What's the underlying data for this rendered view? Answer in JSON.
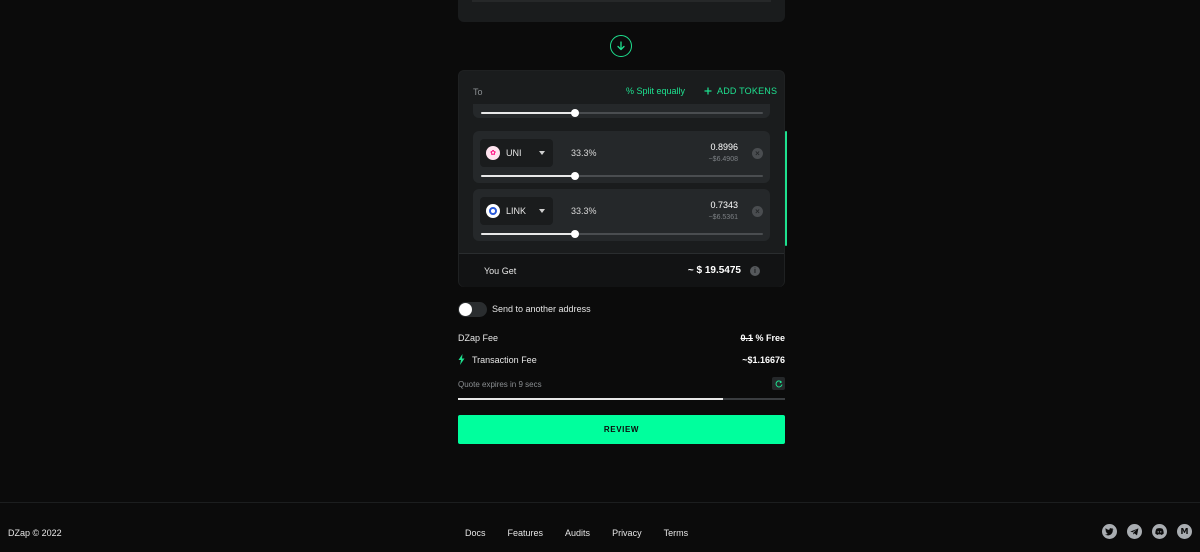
{
  "to_card": {
    "label": "To",
    "split_label": "% Split equally",
    "add_tokens_label": "ADD TOKENS",
    "top_row_fill": 0.333,
    "tokens": [
      {
        "symbol": "UNI",
        "percent": "33.3%",
        "amount": "0.8996",
        "usd": "~$6.4908",
        "fill": 0.333
      },
      {
        "symbol": "LINK",
        "percent": "33.3%",
        "amount": "0.7343",
        "usd": "~$6.5361",
        "fill": 0.333
      }
    ],
    "you_get_label": "You Get",
    "you_get_value": "~ $ 19.5475"
  },
  "send_toggle": {
    "label": "Send to another address",
    "on": false
  },
  "fees": {
    "dzap_label": "DZap Fee",
    "dzap_old": "0.1",
    "dzap_value": " % Free",
    "tx_label": "Transaction Fee",
    "tx_value": "~$1.16676"
  },
  "quote": {
    "label": "Quote expires in 9 secs",
    "progress": 0.81
  },
  "review_label": "REVIEW",
  "footer": {
    "copyright": "DZap © 2022",
    "links": [
      "Docs",
      "Features",
      "Audits",
      "Privacy",
      "Terms"
    ],
    "socials": [
      "twitter-icon",
      "telegram-icon",
      "discord-icon",
      "medium-icon"
    ]
  },
  "colors": {
    "accent": "#1ee08f",
    "review": "#00ff9d",
    "card": "#1a1c1d",
    "row": "#25282a",
    "bg": "#0b0b0b"
  }
}
